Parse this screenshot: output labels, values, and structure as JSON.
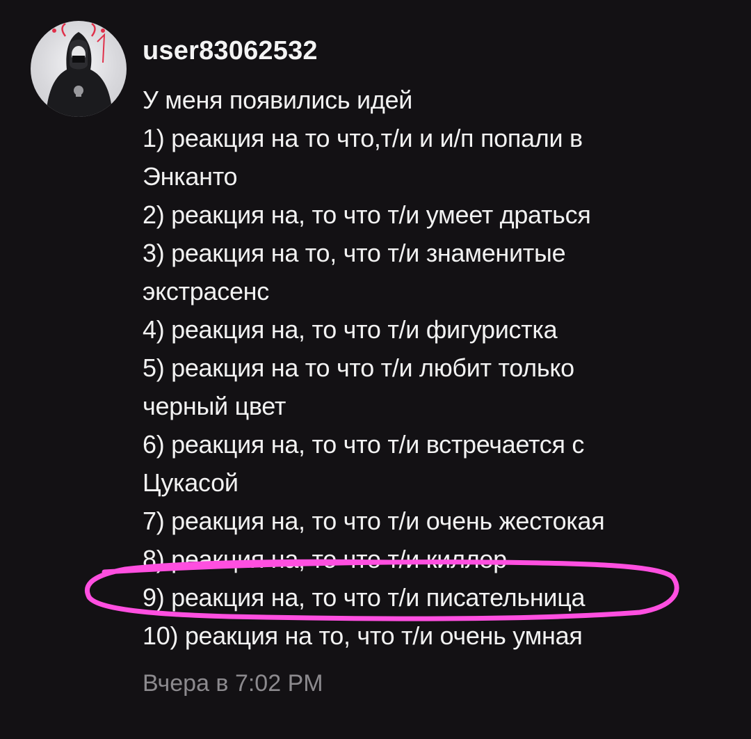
{
  "comment": {
    "username": "user83062532",
    "avatar_icon": "user-avatar-icon",
    "lines": [
      "У меня появились идей",
      "1) реакция на то что,т/и и и/п попали в",
      "Энканто",
      "2) реакция на, то что т/и умеет драться",
      "3) реакция на то, что т/и знаменитые",
      "экстрасенс",
      "4) реакция на, то что т/и фигуристка",
      "5) реакция на то что т/и любит только",
      "черный цвет",
      "6) реакция на, то что т/и встречается с",
      "Цукасой",
      "7) реакция на, то что т/и очень жестокая",
      "8) реакция на, то что т/и киллер",
      "9) реакция на, то что т/и писательница",
      "10) реакция на то, что т/и очень умная"
    ],
    "timestamp": "Вчера в 7:02 PM"
  },
  "colors": {
    "background": "#131114",
    "text": "#f2f2f2",
    "timestamp": "#8c8a8e",
    "highlight_stroke": "#ff4fe0"
  }
}
